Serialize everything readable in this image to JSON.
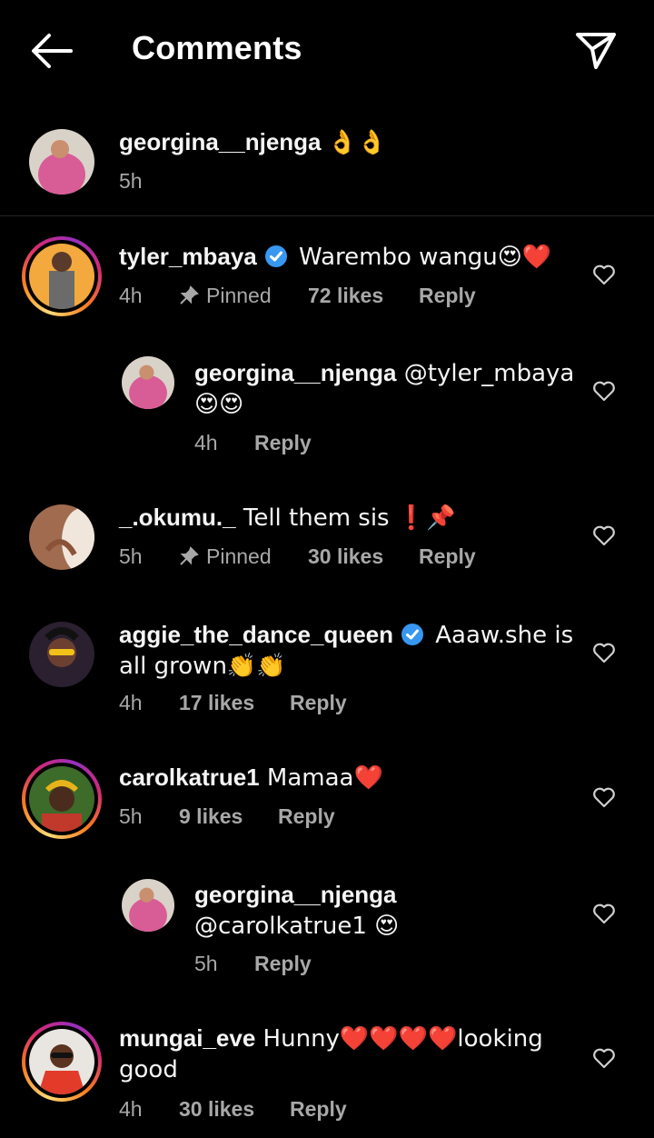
{
  "header": {
    "title": "Comments"
  },
  "caption": {
    "username": "georgina__njenga",
    "emoji": "👌👌",
    "time": "5h"
  },
  "comments": [
    {
      "username": "tyler_mbaya",
      "verified": true,
      "text": " Warembo wangu😍❤️",
      "time": "4h",
      "pinned": "Pinned",
      "likes": "72 likes",
      "reply": "Reply"
    },
    {
      "username": "georgina__njenga",
      "text": " @tyler_mbaya 😍😍",
      "time": "4h",
      "reply": "Reply"
    },
    {
      "username": "_.okumu._",
      "text": " Tell them sis ❗📌",
      "time": "5h",
      "pinned": "Pinned",
      "likes": "30 likes",
      "reply": "Reply"
    },
    {
      "username": "aggie_the_dance_queen",
      "verified": true,
      "text": " Aaaw.she is all grown👏👏",
      "time": "4h",
      "likes": "17 likes",
      "reply": "Reply"
    },
    {
      "username": "carolkatrue1",
      "text": " Mamaa❤️",
      "time": "5h",
      "likes": "9 likes",
      "reply": "Reply"
    },
    {
      "username": "georgina__njenga",
      "text": " @carolkatrue1 😍",
      "time": "5h",
      "reply": "Reply"
    },
    {
      "username": "mungai_eve",
      "text": " Hunny❤️❤️❤️❤️looking good",
      "time": "4h",
      "likes": "30 likes",
      "reply": "Reply"
    }
  ],
  "colors": {
    "verified": "#3897f0",
    "meta": "#a8a8a8",
    "divider": "#262626"
  }
}
